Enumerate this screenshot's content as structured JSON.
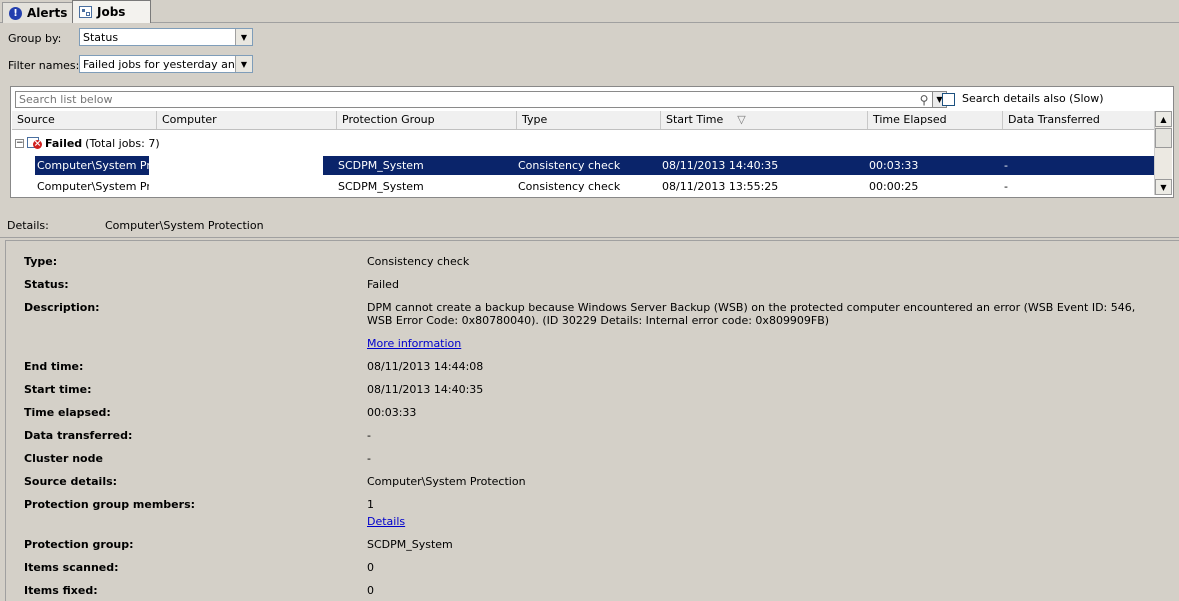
{
  "tabs": [
    {
      "label": "Alerts",
      "icon": "alert-icon"
    },
    {
      "label": "Jobs",
      "icon": "jobs-icon"
    }
  ],
  "filters": {
    "group_by_label": "Group by:",
    "group_by_value": "Status",
    "filter_names_label": "Filter names:",
    "filter_names_value": "Failed jobs for yesterday and tod"
  },
  "search": {
    "placeholder": "Search list below",
    "details_checkbox_label": "Search details also (Slow)"
  },
  "table": {
    "columns": [
      "Source",
      "Computer",
      "Protection Group",
      "Type",
      "Start Time",
      "Time Elapsed",
      "Data Transferred"
    ],
    "sort_column": "Start Time",
    "group": {
      "name": "Failed",
      "count_text": "(Total jobs: 7)"
    },
    "rows": [
      {
        "source": "Computer\\System  Pr...",
        "computer": "",
        "protection_group": "SCDPM_System",
        "type": "Consistency check",
        "start_time": "08/11/2013 14:40:35",
        "time_elapsed": "00:03:33",
        "data_transferred": "-",
        "selected": true
      },
      {
        "source": "Computer\\System  Pr...",
        "computer": "",
        "protection_group": "SCDPM_System",
        "type": "Consistency check",
        "start_time": "08/11/2013 13:55:25",
        "time_elapsed": "00:00:25",
        "data_transferred": "-",
        "selected": false
      }
    ]
  },
  "details": {
    "label": "Details:",
    "title": "Computer\\System Protection",
    "fields": {
      "type": {
        "label": "Type:",
        "value": "Consistency check"
      },
      "status": {
        "label": "Status:",
        "value": "Failed"
      },
      "description": {
        "label": "Description:",
        "value": "DPM cannot create a backup because Windows Server Backup (WSB) on the protected computer encountered an error (WSB Event ID: 546, WSB Error Code: 0x80780040). (ID 30229 Details: Internal error code: 0x809909FB)",
        "link": "More information"
      },
      "end_time": {
        "label": "End time:",
        "value": "08/11/2013 14:44:08"
      },
      "start_time": {
        "label": "Start time:",
        "value": "08/11/2013 14:40:35"
      },
      "time_elapsed": {
        "label": "Time elapsed:",
        "value": "00:03:33"
      },
      "data_transferred": {
        "label": "Data transferred:",
        "value": "-"
      },
      "cluster_node": {
        "label": "Cluster node",
        "value": "-"
      },
      "source_details": {
        "label": "Source details:",
        "value": "Computer\\System Protection"
      },
      "pg_members": {
        "label": "Protection group members:",
        "value": "1",
        "link": "Details"
      },
      "protection_group": {
        "label": "Protection group:",
        "value": "SCDPM_System"
      },
      "items_scanned": {
        "label": "Items scanned:",
        "value": "0"
      },
      "items_fixed": {
        "label": "Items fixed:",
        "value": "0"
      }
    }
  }
}
